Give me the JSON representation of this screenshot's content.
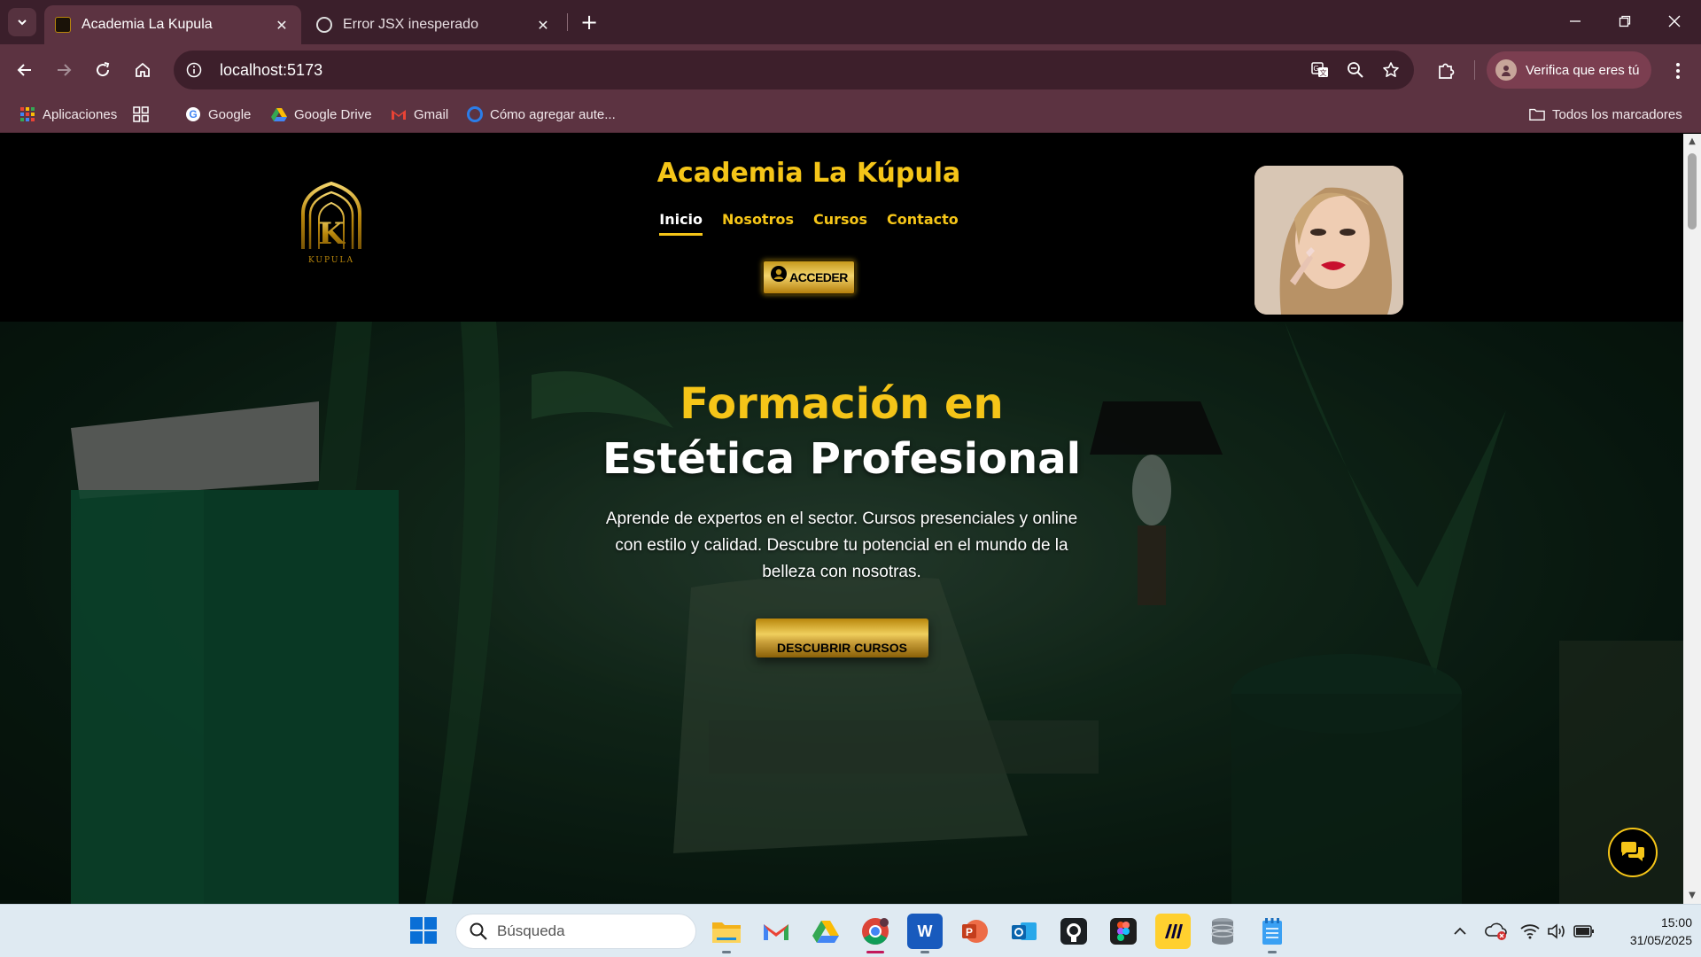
{
  "browser": {
    "tabs": [
      {
        "title": "Academia La Kupula",
        "active": true
      },
      {
        "title": "Error JSX inesperado",
        "active": false
      }
    ],
    "url": "localhost:5173",
    "profile_label": "Verifica que eres tú",
    "bookmarks": [
      {
        "label": "Aplicaciones",
        "icon": "apps-grid-icon"
      },
      {
        "label": "Google",
        "icon": "google-icon"
      },
      {
        "label": "Google Drive",
        "icon": "google-drive-icon"
      },
      {
        "label": "Gmail",
        "icon": "gmail-icon"
      },
      {
        "label": "Cómo agregar aute...",
        "icon": "edge-icon"
      }
    ],
    "all_bookmarks_label": "Todos los marcadores",
    "colors": {
      "frame": "#3b1f2b",
      "toolbar": "#5c3341",
      "omnibox": "#3d1f2b"
    }
  },
  "site": {
    "title": "Academia La Kúpula",
    "logo_text": "KUPULA",
    "nav": [
      {
        "label": "Inicio",
        "current": true
      },
      {
        "label": "Nosotros",
        "current": false
      },
      {
        "label": "Cursos",
        "current": false
      },
      {
        "label": "Contacto",
        "current": false
      }
    ],
    "login_button": "ACCEDER",
    "hero": {
      "title_line1": "Formación en",
      "title_line2": "Estética Profesional",
      "text": "Aprende de expertos en el sector. Cursos presenciales y online con estilo y calidad. Descubre tu potencial en el mundo de la belleza con nosotras.",
      "cta": "DESCUBRIR CURSOS"
    },
    "colors": {
      "gold": "#f5c518",
      "background": "#000000"
    }
  },
  "taskbar": {
    "search_placeholder": "Búsqueda",
    "apps": [
      "file-explorer-icon",
      "gmail-icon",
      "google-drive-icon",
      "chrome-icon",
      "word-icon",
      "powerpoint-icon",
      "outlook-icon",
      "github-icon",
      "figma-icon",
      "miro-icon",
      "database-icon",
      "notepad-icon"
    ],
    "time": "15:00",
    "date": "31/05/2025"
  }
}
